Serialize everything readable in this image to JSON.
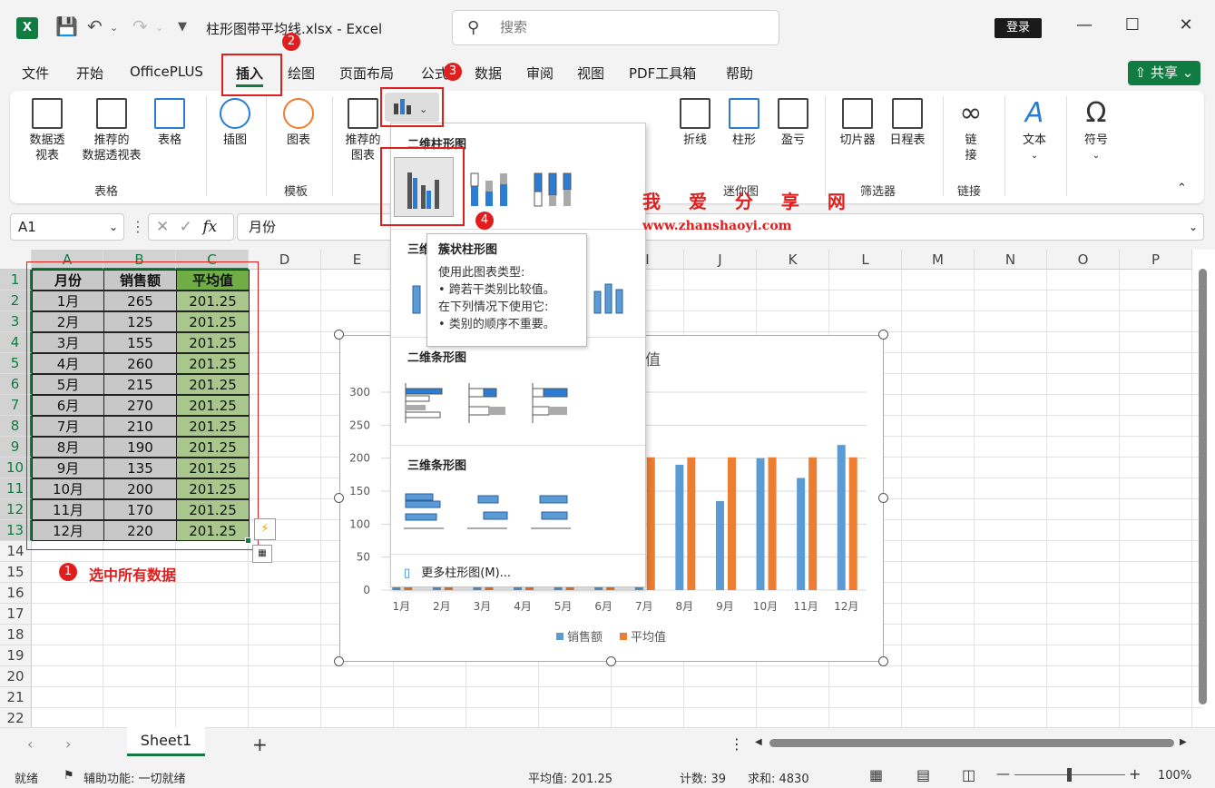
{
  "titlebar": {
    "app_icon": "X",
    "doc_title": "柱形图带平均线.xlsx  -  Excel",
    "search_placeholder": "搜索",
    "login": "登录"
  },
  "menu": {
    "tabs": [
      "文件",
      "开始",
      "OfficePLUS",
      "插入",
      "绘图",
      "页面布局",
      "公式",
      "数据",
      "审阅",
      "视图",
      "PDF工具箱",
      "帮助"
    ],
    "active": "插入",
    "share": "共享"
  },
  "ribbon": {
    "pivot_table": "数据透\n视表",
    "recommended_pivot": "推荐的\n数据透视表",
    "table": "表格",
    "illustrations": "插图",
    "chart_template": "图表",
    "recommended_charts": "推荐的\n图表",
    "line": "折线",
    "column": "柱形",
    "winloss": "盈亏",
    "slicer": "切片器",
    "timeline": "日程表",
    "link": "链\n接",
    "text": "文本",
    "symbol": "符号",
    "groups": {
      "tables": "表格",
      "templates": "模板",
      "sparklines": "迷你图",
      "filters": "筛选器",
      "links": "链接"
    }
  },
  "formula_bar": {
    "name_box": "A1",
    "fx": "fx",
    "formula": "月份"
  },
  "columns": [
    "A",
    "B",
    "C",
    "D",
    "E",
    "F",
    "G",
    "H",
    "I",
    "J",
    "K",
    "L",
    "M",
    "N",
    "O",
    "P"
  ],
  "rows": [
    "1",
    "2",
    "3",
    "4",
    "5",
    "6",
    "7",
    "8",
    "9",
    "10",
    "11",
    "12",
    "13",
    "14",
    "15",
    "16",
    "17",
    "18",
    "19",
    "20",
    "21",
    "22"
  ],
  "table": {
    "headers": [
      "月份",
      "销售额",
      "平均值"
    ],
    "rows": [
      [
        "1月",
        "265",
        "201.25"
      ],
      [
        "2月",
        "125",
        "201.25"
      ],
      [
        "3月",
        "155",
        "201.25"
      ],
      [
        "4月",
        "260",
        "201.25"
      ],
      [
        "5月",
        "215",
        "201.25"
      ],
      [
        "6月",
        "270",
        "201.25"
      ],
      [
        "7月",
        "210",
        "201.25"
      ],
      [
        "8月",
        "190",
        "201.25"
      ],
      [
        "9月",
        "135",
        "201.25"
      ],
      [
        "10月",
        "200",
        "201.25"
      ],
      [
        "11月",
        "170",
        "201.25"
      ],
      [
        "12月",
        "220",
        "201.25"
      ]
    ]
  },
  "chart_data": {
    "type": "bar",
    "categories": [
      "1月",
      "2月",
      "3月",
      "4月",
      "5月",
      "6月",
      "7月",
      "8月",
      "9月",
      "10月",
      "11月",
      "12月"
    ],
    "series": [
      {
        "name": "销售额",
        "values": [
          265,
          125,
          155,
          260,
          215,
          270,
          210,
          190,
          135,
          200,
          170,
          220
        ],
        "color": "#5b9bd5"
      },
      {
        "name": "平均值",
        "values": [
          201.25,
          201.25,
          201.25,
          201.25,
          201.25,
          201.25,
          201.25,
          201.25,
          201.25,
          201.25,
          201.25,
          201.25
        ],
        "color": "#ed7d31"
      }
    ],
    "yticks": [
      0,
      50,
      100,
      150,
      200,
      250,
      300
    ],
    "ylim": [
      0,
      300
    ],
    "legend": "bottom",
    "grid": true,
    "title_fragment": "值"
  },
  "dropdown": {
    "section_2d_column": "二维柱形图",
    "section_3d_column": "三维",
    "section_2d_bar": "二维条形图",
    "section_3d_bar": "三维条形图",
    "more": "更多柱形图(M)..."
  },
  "tooltip": {
    "title": "簇状柱形图",
    "line1": "使用此图表类型:",
    "line2": "• 跨若干类别比较值。",
    "line3": "在下列情况下使用它:",
    "line4": "• 类别的顺序不重要。"
  },
  "annotations": {
    "badge1": "1",
    "badge2": "2",
    "badge3": "3",
    "badge4": "4",
    "text1": "选中所有数据",
    "watermark_cn": "我 爱 分 享 网",
    "watermark_url": "www.zhanshaoyi.com"
  },
  "sheets": {
    "active": "Sheet1",
    "add": "+"
  },
  "status": {
    "ready": "就绪",
    "accessibility": "辅助功能: 一切就绪",
    "average": "平均值: 201.25",
    "count": "计数: 39",
    "sum": "求和: 4830",
    "zoom": "100%"
  },
  "colors": {
    "excel_green": "#107c41",
    "annotation_red": "#e01e1e",
    "series_blue": "#5b9bd5",
    "series_orange": "#ed7d31"
  }
}
